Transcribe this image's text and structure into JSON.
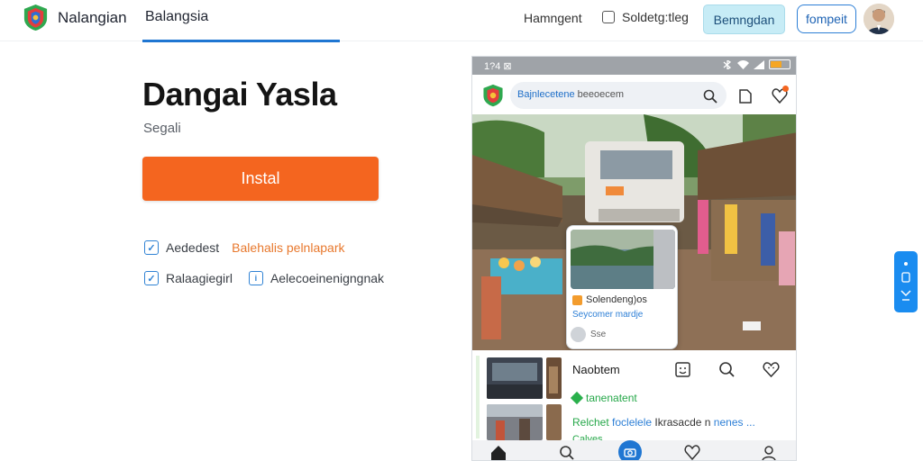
{
  "header": {
    "brand": "Nalangian",
    "nav_tab": "Balangsia",
    "link": "Hamngent",
    "checkbox_label": "Soldetg:tleg",
    "primary_button": "Bemngdan",
    "outline_button": "fompeit"
  },
  "hero": {
    "title": "Dangai Yasla",
    "subtitle": "Segali",
    "install_label": "Instal",
    "features": [
      {
        "label": "Aededest",
        "highlight": "Balehalis pelnlapark"
      },
      {
        "label": "Ralaagiegirl",
        "extra": "Aelecoeinenigngnak"
      }
    ]
  },
  "phone": {
    "status_time": "1?4 ⊠",
    "search_text": "Bajnlecetene",
    "search_suffix": "beeoecem",
    "card": {
      "title": "Solendeng)os",
      "subtitle": "Seycomer mardje",
      "footer": "Sse"
    },
    "feed": {
      "title": "Naobtem",
      "green_label": "tanenatent",
      "line2_green": "Relchet",
      "line2_blue": "foclelele",
      "line2_dark": "Ikrasacde n",
      "line2_tail": "nenes ...",
      "line3": "Calyes"
    }
  },
  "colors": {
    "accent_orange": "#f4651f",
    "accent_blue": "#1f76d2",
    "link_green": "#27a84a"
  },
  "icons": {
    "logo": "shield-logo-icon",
    "search": "search-icon",
    "doc": "document-icon",
    "heart": "heart-icon",
    "home": "home-icon",
    "camera": "camera-icon",
    "profile": "profile-icon"
  }
}
